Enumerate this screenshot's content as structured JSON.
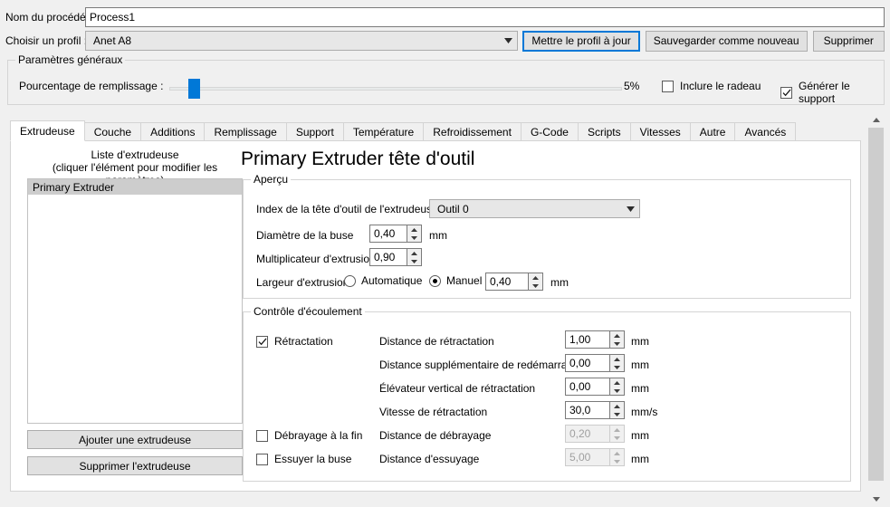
{
  "header": {
    "process_name_label": "Nom du procédé :",
    "process_name_value": "Process1",
    "profile_label": "Choisir un profil :",
    "profile_value": "Anet A8",
    "update_profile_button": "Mettre le profil à jour",
    "save_as_new_button": "Sauvegarder comme nouveau",
    "delete_button": "Supprimer"
  },
  "general": {
    "legend": "Paramètres généraux",
    "fill_label": "Pourcentage de remplissage :",
    "fill_value": "5%",
    "fill_percent": 5,
    "raft_label": "Inclure le radeau",
    "raft_checked": false,
    "support_label": "Générer le support",
    "support_checked": true
  },
  "tabs": [
    {
      "label": "Extrudeuse",
      "active": true
    },
    {
      "label": "Couche",
      "active": false
    },
    {
      "label": "Additions",
      "active": false
    },
    {
      "label": "Remplissage",
      "active": false
    },
    {
      "label": "Support",
      "active": false
    },
    {
      "label": "Température",
      "active": false
    },
    {
      "label": "Refroidissement",
      "active": false
    },
    {
      "label": "G-Code",
      "active": false
    },
    {
      "label": "Scripts",
      "active": false
    },
    {
      "label": "Vitesses",
      "active": false
    },
    {
      "label": "Autre",
      "active": false
    },
    {
      "label": "Avancés",
      "active": false
    }
  ],
  "extruder_panel": {
    "list_title_line1": "Liste d'extrudeuse",
    "list_title_line2": "(cliquer l'élément pour modifier les paramètres)",
    "list_items": [
      {
        "label": "Primary Extruder",
        "selected": true
      }
    ],
    "add_button": "Ajouter une extrudeuse",
    "delete_button": "Supprimer l'extrudeuse",
    "heading": "Primary Extruder tête d'outil"
  },
  "apercu": {
    "legend": "Aperçu",
    "toolhead_index_label": "Index de la tête d'outil de l'extrudeuse",
    "toolhead_index_value": "Outil 0",
    "nozzle_diameter_label": "Diamètre de la buse",
    "nozzle_diameter_value": "0,40",
    "nozzle_diameter_unit": "mm",
    "extrusion_multiplier_label": "Multiplicateur d'extrusion",
    "extrusion_multiplier_value": "0,90",
    "extrusion_width_label": "Largeur d'extrusion",
    "extrusion_width_auto_label": "Automatique",
    "extrusion_width_auto_selected": false,
    "extrusion_width_manual_label": "Manuel",
    "extrusion_width_manual_selected": true,
    "extrusion_width_value": "0,40",
    "extrusion_width_unit": "mm"
  },
  "flow": {
    "legend": "Contrôle d'écoulement",
    "retraction_label": "Rétractation",
    "retraction_checked": true,
    "retraction_distance_label": "Distance de rétractation",
    "retraction_distance_value": "1,00",
    "retraction_distance_unit": "mm",
    "extra_restart_label": "Distance supplémentaire de redémarrage",
    "extra_restart_value": "0,00",
    "extra_restart_unit": "mm",
    "vertical_lift_label": "Élévateur vertical de rétractation",
    "vertical_lift_value": "0,00",
    "vertical_lift_unit": "mm",
    "retraction_speed_label": "Vitesse de rétractation",
    "retraction_speed_value": "30,0",
    "retraction_speed_unit": "mm/s",
    "coast_label": "Débrayage à la fin",
    "coast_checked": false,
    "coast_distance_label": "Distance de débrayage",
    "coast_distance_value": "0,20",
    "coast_distance_unit": "mm",
    "wipe_label": "Essuyer la buse",
    "wipe_checked": false,
    "wipe_distance_label": "Distance d'essuyage",
    "wipe_distance_value": "5,00",
    "wipe_distance_unit": "mm"
  },
  "colors": {
    "accent": "#0078d7",
    "window_bg": "#f0f0f0",
    "panel_bg": "#ffffff",
    "button_bg": "#e1e1e1",
    "selection_bg": "#cdcdcd"
  }
}
